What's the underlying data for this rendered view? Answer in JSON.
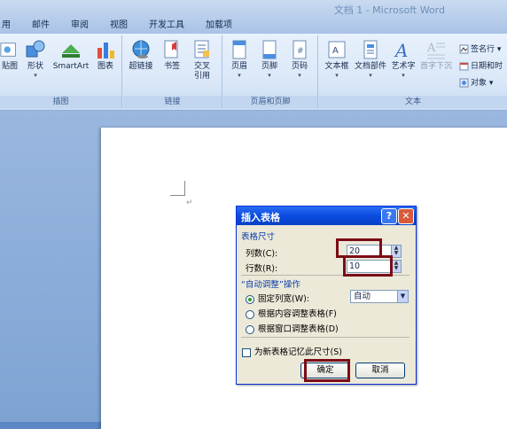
{
  "window": {
    "title": "文档 1 - Microsoft Word"
  },
  "tabs": [
    "用",
    "邮件",
    "审阅",
    "视图",
    "开发工具",
    "加载项"
  ],
  "ribbon": {
    "groups": {
      "illustrations": {
        "label": "插图",
        "buttons": [
          "贴图",
          "形状",
          "SmartArt",
          "图表"
        ]
      },
      "links": {
        "label": "链接",
        "buttons": [
          "超链接",
          "书签",
          "交叉",
          "引用"
        ]
      },
      "headerfooter": {
        "label": "页眉和页脚",
        "buttons": [
          "页眉",
          "页脚",
          "页码"
        ]
      },
      "text": {
        "label": "文本",
        "buttons": [
          "文本框",
          "文档部件",
          "艺术字",
          "首字下沉"
        ],
        "small": [
          "签名行",
          "日期和时",
          "对象"
        ]
      }
    }
  },
  "dialog": {
    "title": "插入表格",
    "help": "?",
    "close": "✕",
    "size_section": "表格尺寸",
    "columns_label": "列数(C):",
    "columns_value": "20",
    "rows_label": "行数(R):",
    "rows_value": "10",
    "autofit_section": "“自动调整”操作",
    "fixed_label": "固定列宽(W):",
    "fixed_value": "自动",
    "content_label": "根据内容调整表格(F)",
    "window_label": "根据窗口调整表格(D)",
    "remember_label": "为新表格记忆此尺寸(S)",
    "ok": "确定",
    "cancel": "取消"
  },
  "doc": {
    "paragraph_mark": "↵"
  },
  "colors": {
    "highlight": "#7b0c16",
    "accent": "#0a4ce0"
  }
}
